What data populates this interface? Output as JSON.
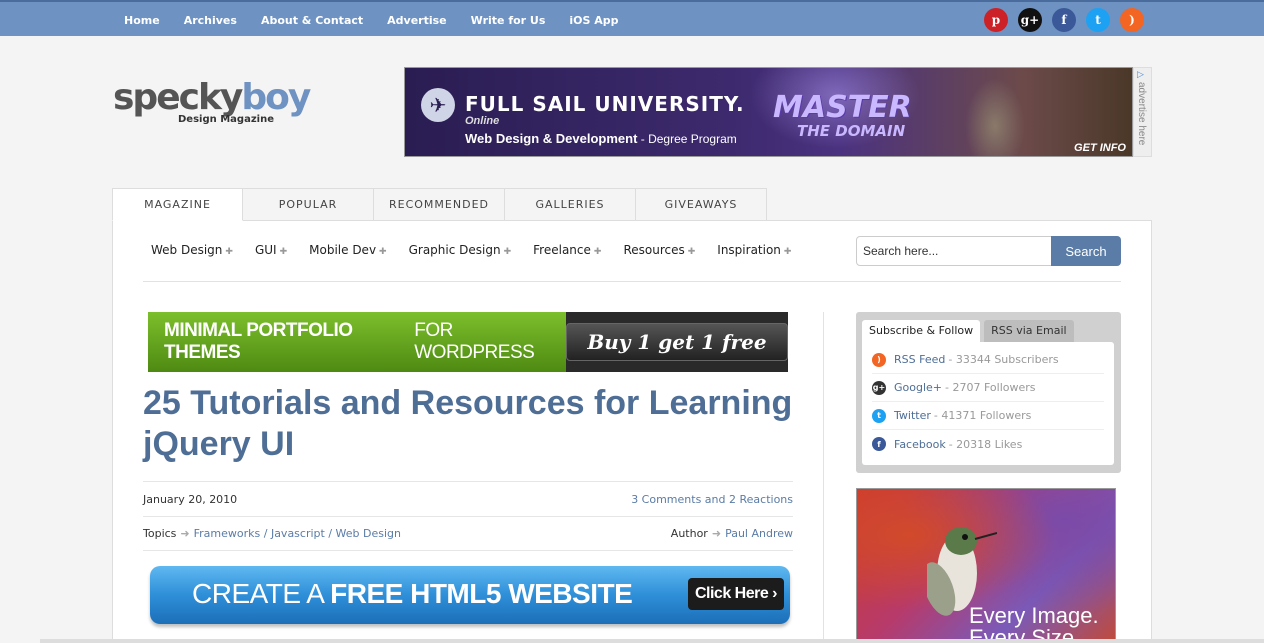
{
  "topnav": {
    "items": [
      "Home",
      "Archives",
      "About & Contact",
      "Advertise",
      "Write for Us",
      "iOS App"
    ]
  },
  "social": [
    {
      "icon": "pinterest-icon",
      "glyph": "p",
      "color": "#cc2127"
    },
    {
      "icon": "googleplus-icon",
      "glyph": "g+",
      "color": "#111111"
    },
    {
      "icon": "facebook-icon",
      "glyph": "f",
      "color": "#3b5998"
    },
    {
      "icon": "twitter-icon",
      "glyph": "t",
      "color": "#1da1f2"
    },
    {
      "icon": "rss-icon",
      "glyph": ")",
      "color": "#f26522"
    }
  ],
  "logo": {
    "word_a": "specky",
    "word_b": "boy",
    "sub": "Design Magazine"
  },
  "banner_ad": {
    "university": "FULL SAIL UNIVERSITY.",
    "online": "Online",
    "program_bold": "Web Design & Development",
    "program_rest": " - Degree Program",
    "master": "MASTER",
    "domain": "THE DOMAIN",
    "cta": "GET INFO",
    "side_label": "advertise here"
  },
  "tabs": [
    "MAGAZINE",
    "POPULAR",
    "RECOMMENDED",
    "GALLERIES",
    "GIVEAWAYS"
  ],
  "subnav": [
    "Web Design",
    "GUI",
    "Mobile Dev",
    "Graphic Design",
    "Freelance",
    "Resources",
    "Inspiration"
  ],
  "search": {
    "placeholder": "Search here...",
    "button": "Search"
  },
  "portfolio_ad": {
    "bold": "MINIMAL PORTFOLIO THEMES",
    "rest": " FOR WORDPRESS",
    "cta": "Buy 1 get 1 free"
  },
  "article": {
    "title": "25 Tutorials and Resources for Learning jQuery UI",
    "date": "January 20, 2010",
    "comments": "3 Comments and 2 Reactions",
    "topics_label": "Topics",
    "topics": "Frameworks / Javascript / Web Design",
    "author_label": "Author",
    "author": "Paul Andrew"
  },
  "html5_ad": {
    "light": "CREATE A ",
    "bold": "FREE HTML5 WEBSITE",
    "cta": "Click Here"
  },
  "follow": {
    "tab_active": "Subscribe & Follow",
    "tab_inactive": "RSS via Email",
    "rows": [
      {
        "name": "RSS Feed",
        "count": "- 33344 Subscribers",
        "icon": "rss-icon",
        "color": "#f26522"
      },
      {
        "name": "Google+",
        "count": "- 2707 Followers",
        "icon": "googleplus-icon",
        "color": "#333333"
      },
      {
        "name": "Twitter",
        "count": "- 41371 Followers",
        "icon": "twitter-icon",
        "color": "#1da1f2"
      },
      {
        "name": "Facebook",
        "count": "- 20318 Likes",
        "icon": "facebook-icon",
        "color": "#3b5998"
      }
    ]
  },
  "bird_ad": {
    "line1": "Every Image.",
    "line2": "Every Size."
  }
}
